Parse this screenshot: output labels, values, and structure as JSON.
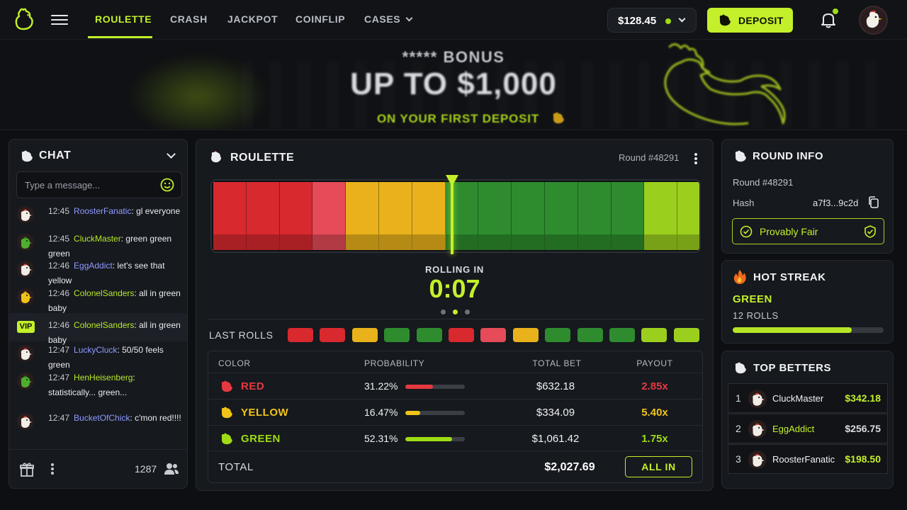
{
  "nav": {
    "tabs": [
      {
        "label": "ROULETTE",
        "active": true
      },
      {
        "label": "CRASH"
      },
      {
        "label": "JACKPOT"
      },
      {
        "label": "COINFLIP"
      },
      {
        "label": "CASES"
      }
    ],
    "balance": "$128.45",
    "deposit_label": "DEPOSIT"
  },
  "banner": {
    "top": "***** BONUS",
    "main": "UP TO $1,000",
    "sub": "ON YOUR FIRST DEPOSIT"
  },
  "chat": {
    "title": "CHAT",
    "placeholder": "Type a message...",
    "messages": [
      {
        "time": "12:45",
        "user": "RoosterFanatic",
        "text": "gl everyone",
        "avatar": "white-chicken",
        "color": "blue"
      },
      {
        "time": "12:45",
        "user": "CluckMaster",
        "text": "green green green",
        "avatar": "green-chicken",
        "color": "green"
      },
      {
        "time": "12:46",
        "user": "EggAddict",
        "text": "let's see that yellow",
        "avatar": "white-chicken",
        "color": "blue"
      },
      {
        "time": "12:46",
        "user": "ColonelSanders",
        "text": "all in green baby",
        "avatar": "yellow-chicken",
        "color": "green"
      },
      {
        "time": "12:46",
        "user": "ColonelSanders",
        "text": "all in green baby",
        "badge": "VIP",
        "color": "green"
      },
      {
        "time": "12:47",
        "user": "LuckyCluck",
        "text": "50/50 feels green",
        "avatar": "white-chicken",
        "color": "blue"
      },
      {
        "time": "12:47",
        "user": "HenHeisenberg",
        "text": "statistically... green...",
        "avatar": "green-chicken",
        "color": "green"
      },
      {
        "time": "12:47",
        "user": "BucketOfChick",
        "text": "c'mon red!!!!",
        "avatar": "white-chicken",
        "color": "blue"
      }
    ],
    "online_count": "1287"
  },
  "roulette": {
    "title": "ROULETTE",
    "round_label": "Round #48291",
    "rolling_label": "ROLLING IN",
    "timer": "0:07",
    "last_rolls_label": "LAST ROLLS",
    "strip_segments": [
      "red",
      "red",
      "red",
      "pink",
      "yellow",
      "yellow",
      "yellow",
      "green",
      "green",
      "green",
      "green",
      "green",
      "green",
      "lime",
      "lime"
    ],
    "last_rolls": [
      "red",
      "red",
      "yellow",
      "green",
      "green",
      "red",
      "pink",
      "yellow",
      "green",
      "green",
      "green",
      "lime",
      "lime"
    ],
    "table": {
      "headers": [
        "COLOR",
        "PROBABILITY",
        "TOTAL BET",
        "PAYOUT"
      ],
      "rows": [
        {
          "color": "RED",
          "probability": "31.22%",
          "probability_value": 31.22,
          "total_bet": "$632.18",
          "payout": "2.85x",
          "hex": "#e5393f"
        },
        {
          "color": "YELLOW",
          "probability": "16.47%",
          "probability_value": 16.47,
          "total_bet": "$334.09",
          "payout": "5.40x",
          "hex": "#f0c419"
        },
        {
          "color": "GREEN",
          "probability": "52.31%",
          "probability_value": 52.31,
          "total_bet": "$1,061.42",
          "payout": "1.75x",
          "hex": "#9fdc15"
        }
      ],
      "total_label": "TOTAL",
      "total_value": "$2,027.69",
      "all_in_label": "ALL IN"
    }
  },
  "round_info": {
    "title": "ROUND INFO",
    "round": "Round #48291",
    "hash_label": "Hash",
    "hash_value": "a7f3...9c2d",
    "provably_fair": "Provably Fair"
  },
  "hot_streak": {
    "title": "HOT STREAK",
    "color": "GREEN",
    "rolls": "12 ROLLS",
    "progress": 0.79
  },
  "top_betters": {
    "title": "TOP BETTERS",
    "rows": [
      {
        "rank": "1",
        "name": "CluckMaster",
        "amount": "$342.18",
        "highlight": true
      },
      {
        "rank": "2",
        "name": "EggAddict",
        "amount": "$256.75",
        "highlight": false
      },
      {
        "rank": "3",
        "name": "RoosterFanatic",
        "amount": "$198.50",
        "highlight": true
      }
    ]
  },
  "colors": {
    "accent": "#c3f02a",
    "red": "#d8292f",
    "pink": "#e54b58",
    "yellow": "#e9b21c",
    "green": "#2e8c2e",
    "lime": "#9bcf1e"
  }
}
